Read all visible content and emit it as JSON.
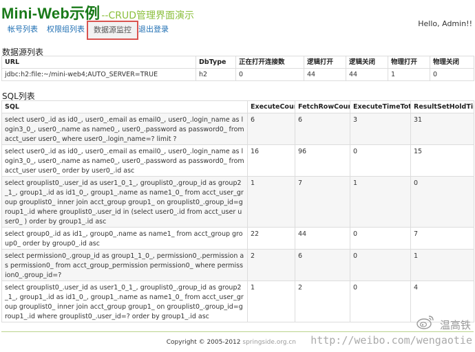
{
  "header": {
    "brand": "Mini-Web示例",
    "subtitle": "--CRUD管理界面演示",
    "greeting": "Hello, Admin!!"
  },
  "nav": {
    "items": [
      {
        "label": "帐号列表"
      },
      {
        "label": "权限组列表"
      },
      {
        "label": "数据源监控",
        "active": true
      },
      {
        "label": "退出登录"
      }
    ]
  },
  "datasource": {
    "title": "数据源列表",
    "headers": [
      "URL",
      "DbType",
      "正在打开连接数",
      "逻辑打开",
      "逻辑关闭",
      "物理打开",
      "物理关闭"
    ],
    "rows": [
      [
        "jdbc:h2:file:~/mini-web4;AUTO_SERVER=TRUE",
        "h2",
        "0",
        "44",
        "44",
        "1",
        "0"
      ]
    ]
  },
  "sql": {
    "title": "SQL列表",
    "headers": [
      "SQL",
      "ExecuteCount",
      "FetchRowCount",
      "ExecuteTimeTotal",
      "ResultSetHoldTime"
    ],
    "rows": [
      [
        "select user0_.id as id0_, user0_.email as email0_, user0_.login_name as login3_0_, user0_.name as name0_, user0_.password as password0_ from acct_user user0_ where user0_.login_name=? limit ?",
        "6",
        "6",
        "3",
        "31"
      ],
      [
        "select user0_.id as id0_, user0_.email as email0_, user0_.login_name as login3_0_, user0_.name as name0_, user0_.password as password0_ from acct_user user0_ order by user0_.id asc",
        "16",
        "96",
        "0",
        "15"
      ],
      [
        "select grouplist0_.user_id as user1_0_1_, grouplist0_.group_id as group2_1_, group1_.id as id1_0_, group1_.name as name1_0_ from acct_user_group grouplist0_ inner join acct_group group1_ on grouplist0_.group_id=group1_.id where grouplist0_.user_id in (select user0_.id from acct_user user0_ ) order by group1_.id asc",
        "1",
        "7",
        "1",
        "0"
      ],
      [
        "select group0_.id as id1_, group0_.name as name1_ from acct_group group0_ order by group0_.id asc",
        "22",
        "44",
        "0",
        "7"
      ],
      [
        "select permission0_.group_id as group1_1_0_, permission0_.permission as permission0_ from acct_group_permission permission0_ where permission0_.group_id=?",
        "2",
        "6",
        "0",
        "1"
      ],
      [
        "select grouplist0_.user_id as user1_0_1_, grouplist0_.group_id as group2_1_, group1_.id as id1_0_, group1_.name as name1_0_ from acct_user_group grouplist0_ inner join acct_group group1_ on grouplist0_.group_id=group1_.id where grouplist0_.user_id=? order by group1_.id asc",
        "1",
        "2",
        "0",
        "4"
      ]
    ]
  },
  "footer": {
    "copyright": "Copyright © 2005-2012",
    "domain": "springside.org.cn"
  },
  "watermark": {
    "name": "温高铁",
    "url": "http://weibo.com/wengaotie",
    "logo_icon": "weibo-logo-icon"
  },
  "colors": {
    "brand": "#1a7a1a",
    "subtitle": "#8bbf3c",
    "link": "#1f6fb3",
    "active_border": "#d9534f"
  }
}
